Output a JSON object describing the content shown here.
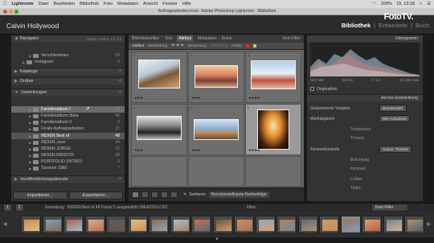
{
  "menubar": {
    "app_name": "Lightroom",
    "items": [
      "Datei",
      "Bearbeiten",
      "Bibliothek",
      "Foto",
      "Metadaten",
      "Ansicht",
      "Fenster",
      "Hilfe"
    ],
    "clock": "Di. 13:18",
    "percent": "100%"
  },
  "window_title": "Auftragsarbeiten.lrcat - Adobe Photoshop Lightroom - Bibliothek",
  "header": {
    "user_name": "Calvin Hollywood",
    "modules": [
      "Bibliothek",
      "|",
      "Entwickeln",
      "|",
      "Buch"
    ],
    "logo": "FotoTV."
  },
  "left_panel": {
    "navigator_label": "Navigator",
    "navigator_options": "Anpas.  Ausfül.  1:1  1:3",
    "folder_rows": [
      {
        "label": "Verschiedenes",
        "count": "33"
      },
      {
        "label": "Instagram",
        "count": "9"
      }
    ],
    "kataloge_label": "Kataloge",
    "ordner_label": "Ordner",
    "sammlungen_label": "Sammlungen",
    "collections": [
      {
        "label": "Familienalbum I",
        "count": "15"
      },
      {
        "label": "Familienalbum Ibiza",
        "count": "46"
      },
      {
        "label": "Familienalbum II",
        "count": "9"
      },
      {
        "label": "Finale Auftragsarbeiten",
        "count": "21"
      },
      {
        "label": "INDIEN Best of",
        "count": "48"
      },
      {
        "label": "INDIEN Jane",
        "count": "44"
      },
      {
        "label": "INDIEN JORGE",
        "count": "22"
      },
      {
        "label": "INDIEN KRISTOF",
        "count": "28"
      },
      {
        "label": "PORTFOLIO (INTRO)",
        "count": "9"
      },
      {
        "label": "Tanzvon 1980",
        "count": "7"
      }
    ],
    "publish_label": "Veröffentlichungsdienste",
    "import_label": "Importieren...",
    "export_label": "Exportieren..."
  },
  "center": {
    "filter_label": "Bibliotheksfilter:",
    "filter_tabs": [
      "Text",
      "Attribut",
      "Metadaten",
      "Keine"
    ],
    "filter_right": "Kein Filter",
    "attr_items": [
      "Attribut",
      "Markierung",
      "Bewertung",
      "Farbe"
    ],
    "cell_numbers": [
      "1",
      "2",
      "3",
      "4",
      "5",
      "6"
    ],
    "cell_stars": [
      "★★★",
      "★★★",
      "★★★★",
      "★★★",
      "★★★",
      "★★★★"
    ],
    "sort_label": "Sortieren:",
    "sort_value": "Benutzerdefinierte Reihenfolge"
  },
  "right_panel": {
    "histogram_label": "Histogramm",
    "histo_info": [
      "ISO 100",
      "35 mm",
      "f / 1,2",
      "1/1.000 Sek."
    ],
    "original_photo_label": "Originalfoto",
    "quick_dev_label": "Ad-hoc-Entwicklung",
    "preset_label": "Gespeicherte Vorgabe",
    "preset_value": "Benutzerdef.",
    "wb_label": "Weißabgleich",
    "wb_value": "Wie Aufnahme",
    "temp_label": "Temperatur",
    "tint_label": "Tönung",
    "tone_label": "Tonwertkontrolle",
    "tone_value": "Autom. Tonwert",
    "exposure_label": "Belichtung",
    "contrast_label": "Kontrast",
    "highlights_label": "Lichter",
    "shadows_label": "Tiefen"
  },
  "filmstrip": {
    "pages": [
      "1",
      "2"
    ],
    "path": "Sammlung : INDIEN Best of  48 Fotos/ 1 ausgewählt/ 08EA2319.CR2",
    "filter_label": "Filter:",
    "no_filter": "Kein Filter"
  },
  "colors": {
    "panel": "#333333",
    "grid_bg": "#666666",
    "accent_selected": "#9a9a9a"
  }
}
